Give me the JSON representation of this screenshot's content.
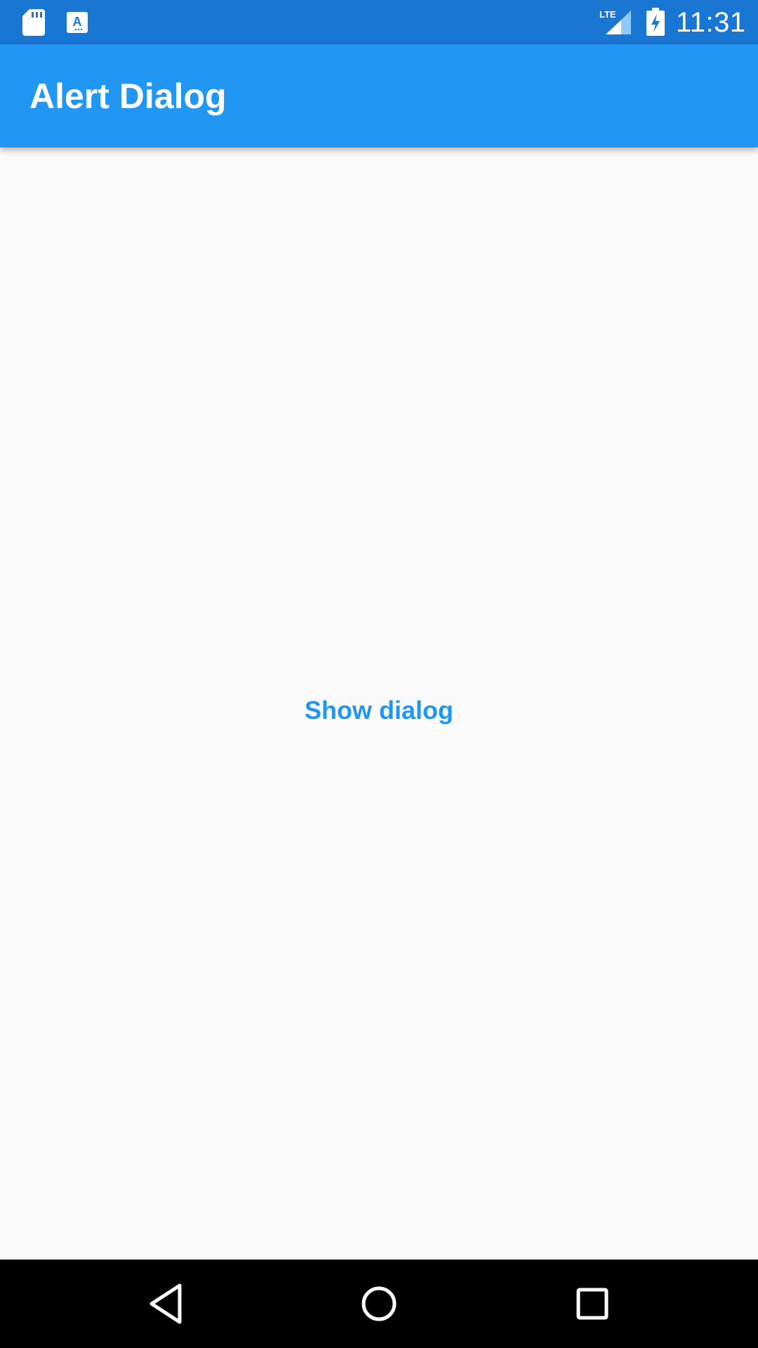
{
  "status_bar": {
    "time": "11:31",
    "network": "LTE",
    "icons": [
      "sd-card-icon",
      "a-notification-icon",
      "lte-signal-icon",
      "battery-charging-icon"
    ],
    "background_color": "#1976D2"
  },
  "app_bar": {
    "title": "Alert Dialog",
    "background_color": "#2196F3"
  },
  "main": {
    "button_label": "Show dialog",
    "accent_color": "#2196F3",
    "background_color": "#FAFAFA"
  },
  "nav_bar": {
    "icons": [
      "back-icon",
      "home-icon",
      "recents-icon"
    ]
  }
}
